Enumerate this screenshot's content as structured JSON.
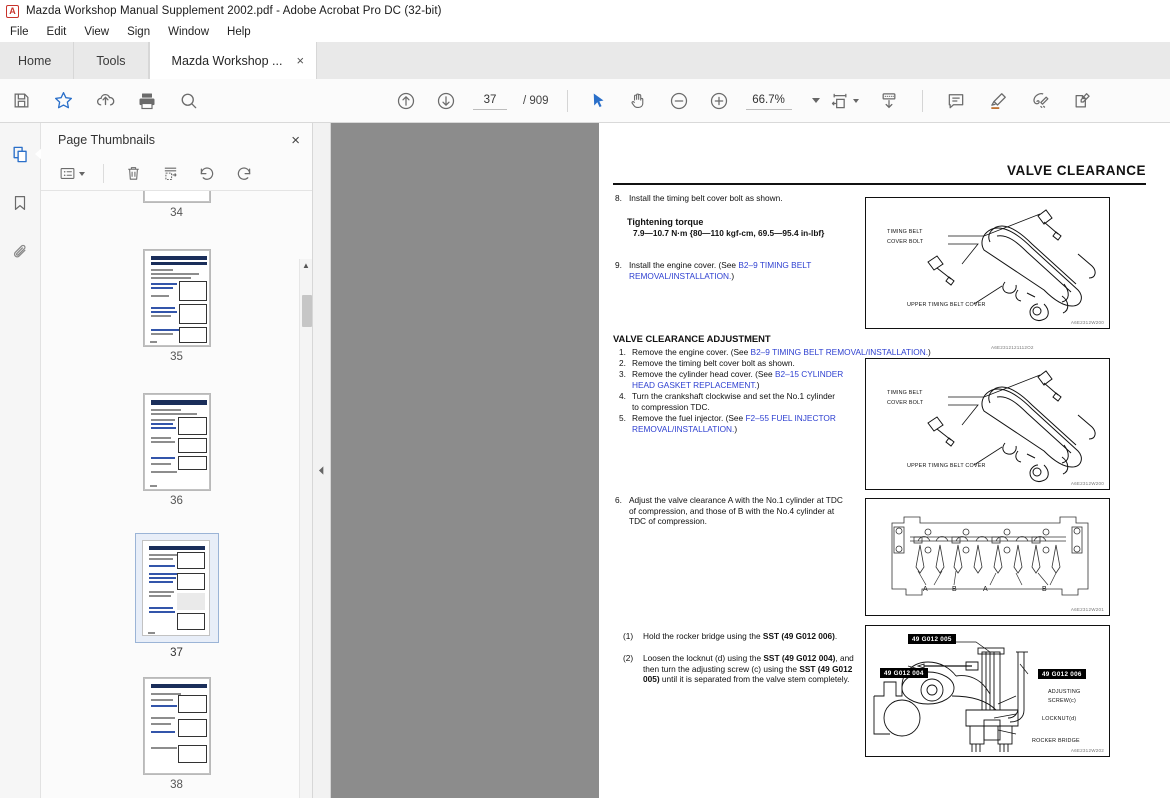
{
  "window": {
    "title": "Mazda  Workshop Manual Supplement 2002.pdf - Adobe Acrobat Pro DC (32-bit)",
    "logo_glyph": "A"
  },
  "menubar": {
    "items": [
      "File",
      "Edit",
      "View",
      "Sign",
      "Window",
      "Help"
    ]
  },
  "tabs": [
    {
      "label": "Home",
      "name": "tab-home",
      "active": false
    },
    {
      "label": "Tools",
      "name": "tab-tools",
      "active": false
    },
    {
      "label": "Mazda  Workshop ...",
      "name": "tab-document",
      "active": true,
      "close": "×"
    }
  ],
  "toolbar": {
    "left_icons": [
      "save-icon",
      "star-icon",
      "upload-cloud-icon",
      "print-icon",
      "zoom-search-icon"
    ],
    "page_prev_label": "previous-page-icon",
    "page_next_label": "next-page-icon",
    "page_number": "37",
    "page_total": "/ 909",
    "select_tool": "select-cursor-icon",
    "hand_tool": "hand-tool-icon",
    "zoom_out": "zoom-out-icon",
    "zoom_in": "zoom-in-icon",
    "zoom_level": "66.7%",
    "fit_page_icon": "fit-page-icon",
    "scroll_mode_icon": "scroll-mode-icon",
    "comment_icon": "comment-icon",
    "highlight_icon": "highlight-icon",
    "sign_icon": "sign-icon",
    "stamp_icon": "stamp-icon"
  },
  "rail": {
    "items": [
      {
        "name": "sidebar-page-thumbnails",
        "icon": "pages-icon",
        "active": true
      },
      {
        "name": "sidebar-bookmarks",
        "icon": "bookmark-icon",
        "active": false
      },
      {
        "name": "sidebar-attachments",
        "icon": "paperclip-icon",
        "active": false
      }
    ]
  },
  "thumbnails_panel": {
    "title": "Page Thumbnails",
    "close_label": "×",
    "toolbar": {
      "options_icon": "list-options-icon",
      "delete_icon": "trash-icon",
      "extract_icon": "extract-pages-icon",
      "rotate_ccw_icon": "rotate-counterclockwise-icon",
      "rotate_cw_icon": "rotate-clockwise-icon"
    },
    "pages": [
      {
        "number": "34",
        "selected": false,
        "partial": true
      },
      {
        "number": "35",
        "selected": false,
        "partial": false
      },
      {
        "number": "36",
        "selected": false,
        "partial": false
      },
      {
        "number": "37",
        "selected": true,
        "partial": false
      },
      {
        "number": "38",
        "selected": false,
        "partial": true
      }
    ]
  },
  "collapse_strip": {
    "icon": "collapse-left-icon"
  },
  "document": {
    "header_title": "VALVE CLEARANCE",
    "step8": {
      "number": "8.",
      "text": "Install the timing belt cover bolt as shown."
    },
    "torque": {
      "heading": "Tightening torque",
      "value": "7.9—10.7 N·m {80—110 kgf-cm, 69.5—95.4 in-lbf}"
    },
    "step9": {
      "number": "9.",
      "pre": "Install the engine cover. (See ",
      "link": "B2–9 TIMING BELT REMOVAL/INSTALLATION.",
      "post": ")"
    },
    "section_heading": "VALVE CLEARANCE ADJUSTMENT",
    "adjustment_steps": [
      {
        "n": "1.",
        "pre": "Remove the engine cover. (See ",
        "link": "B2–9 TIMING BELT REMOVAL/INSTALLATION.",
        "post": ")"
      },
      {
        "n": "2.",
        "pre": "Remove the timing belt cover bolt as shown.",
        "link": "",
        "post": ""
      },
      {
        "n": "3.",
        "pre": "Remove the cylinder head cover. (See ",
        "link": "B2–15 CYLINDER HEAD GASKET REPLACEMENT.",
        "post": ")"
      },
      {
        "n": "4.",
        "pre": "Turn the crankshaft clockwise and set the No.1 cylinder to compression TDC.",
        "link": "",
        "post": ""
      },
      {
        "n": "5.",
        "pre": "Remove the fuel injector. (See ",
        "link": "F2–55 FUEL INJECTOR REMOVAL/INSTALLATION.",
        "post": ")"
      }
    ],
    "step6": {
      "number": "6.",
      "text": "Adjust the valve clearance A with the No.1 cylinder at TDC of compression, and those of B with the No.4 cylinder at TDC of compression."
    },
    "substeps": [
      {
        "n": "(1)",
        "parts": [
          {
            "t": "Hold the rocker bridge using the ",
            "b": false
          },
          {
            "t": "SST (49 G012 006)",
            "b": true
          },
          {
            "t": ".",
            "b": false
          }
        ]
      },
      {
        "n": "(2)",
        "parts": [
          {
            "t": "Loosen the locknut (d) using the ",
            "b": false
          },
          {
            "t": "SST (49 G012 004)",
            "b": true
          },
          {
            "t": ", and then turn the adjusting screw (c) using the ",
            "b": false
          },
          {
            "t": "SST (49 G012 005)",
            "b": true
          },
          {
            "t": " until it is separated from the valve stem completely.",
            "b": false
          }
        ]
      }
    ],
    "figures": [
      {
        "name": "figure-upper-timing-belt-cover-1",
        "code": "A6E2312W200",
        "labels": [
          "TIMING BELT",
          "COVER BOLT",
          "UPPER TIMING BELT COVER"
        ]
      },
      {
        "name": "figure-upper-timing-belt-cover-2",
        "code": "A6E2312W200",
        "top_code": "A6E2312121112O2",
        "labels": [
          "TIMING BELT",
          "COVER BOLT",
          "UPPER TIMING BELT COVER"
        ]
      },
      {
        "name": "figure-rocker-arm-valve-clearance",
        "code": "A6E2312W201",
        "labels": [
          "A",
          "B",
          "A",
          "B"
        ]
      },
      {
        "name": "figure-sst-rocker-bridge",
        "code": "A6E2312W202",
        "badges": [
          "49 G012 005",
          "49 G012 004",
          "49 G012 006"
        ],
        "labels": [
          "ADJUSTING",
          "SCREW(c)",
          "LOCKNUT(d)",
          "ROCKER BRIDGE"
        ]
      }
    ]
  },
  "colors": {
    "link": "#2d3fd0",
    "accent_blue": "#2a6fc9",
    "doc_background": "#8c8c8c",
    "panel_background": "#fbfbfb",
    "tab_inactive": "#e9e9e9",
    "acrobat_red": "#c8332b"
  }
}
